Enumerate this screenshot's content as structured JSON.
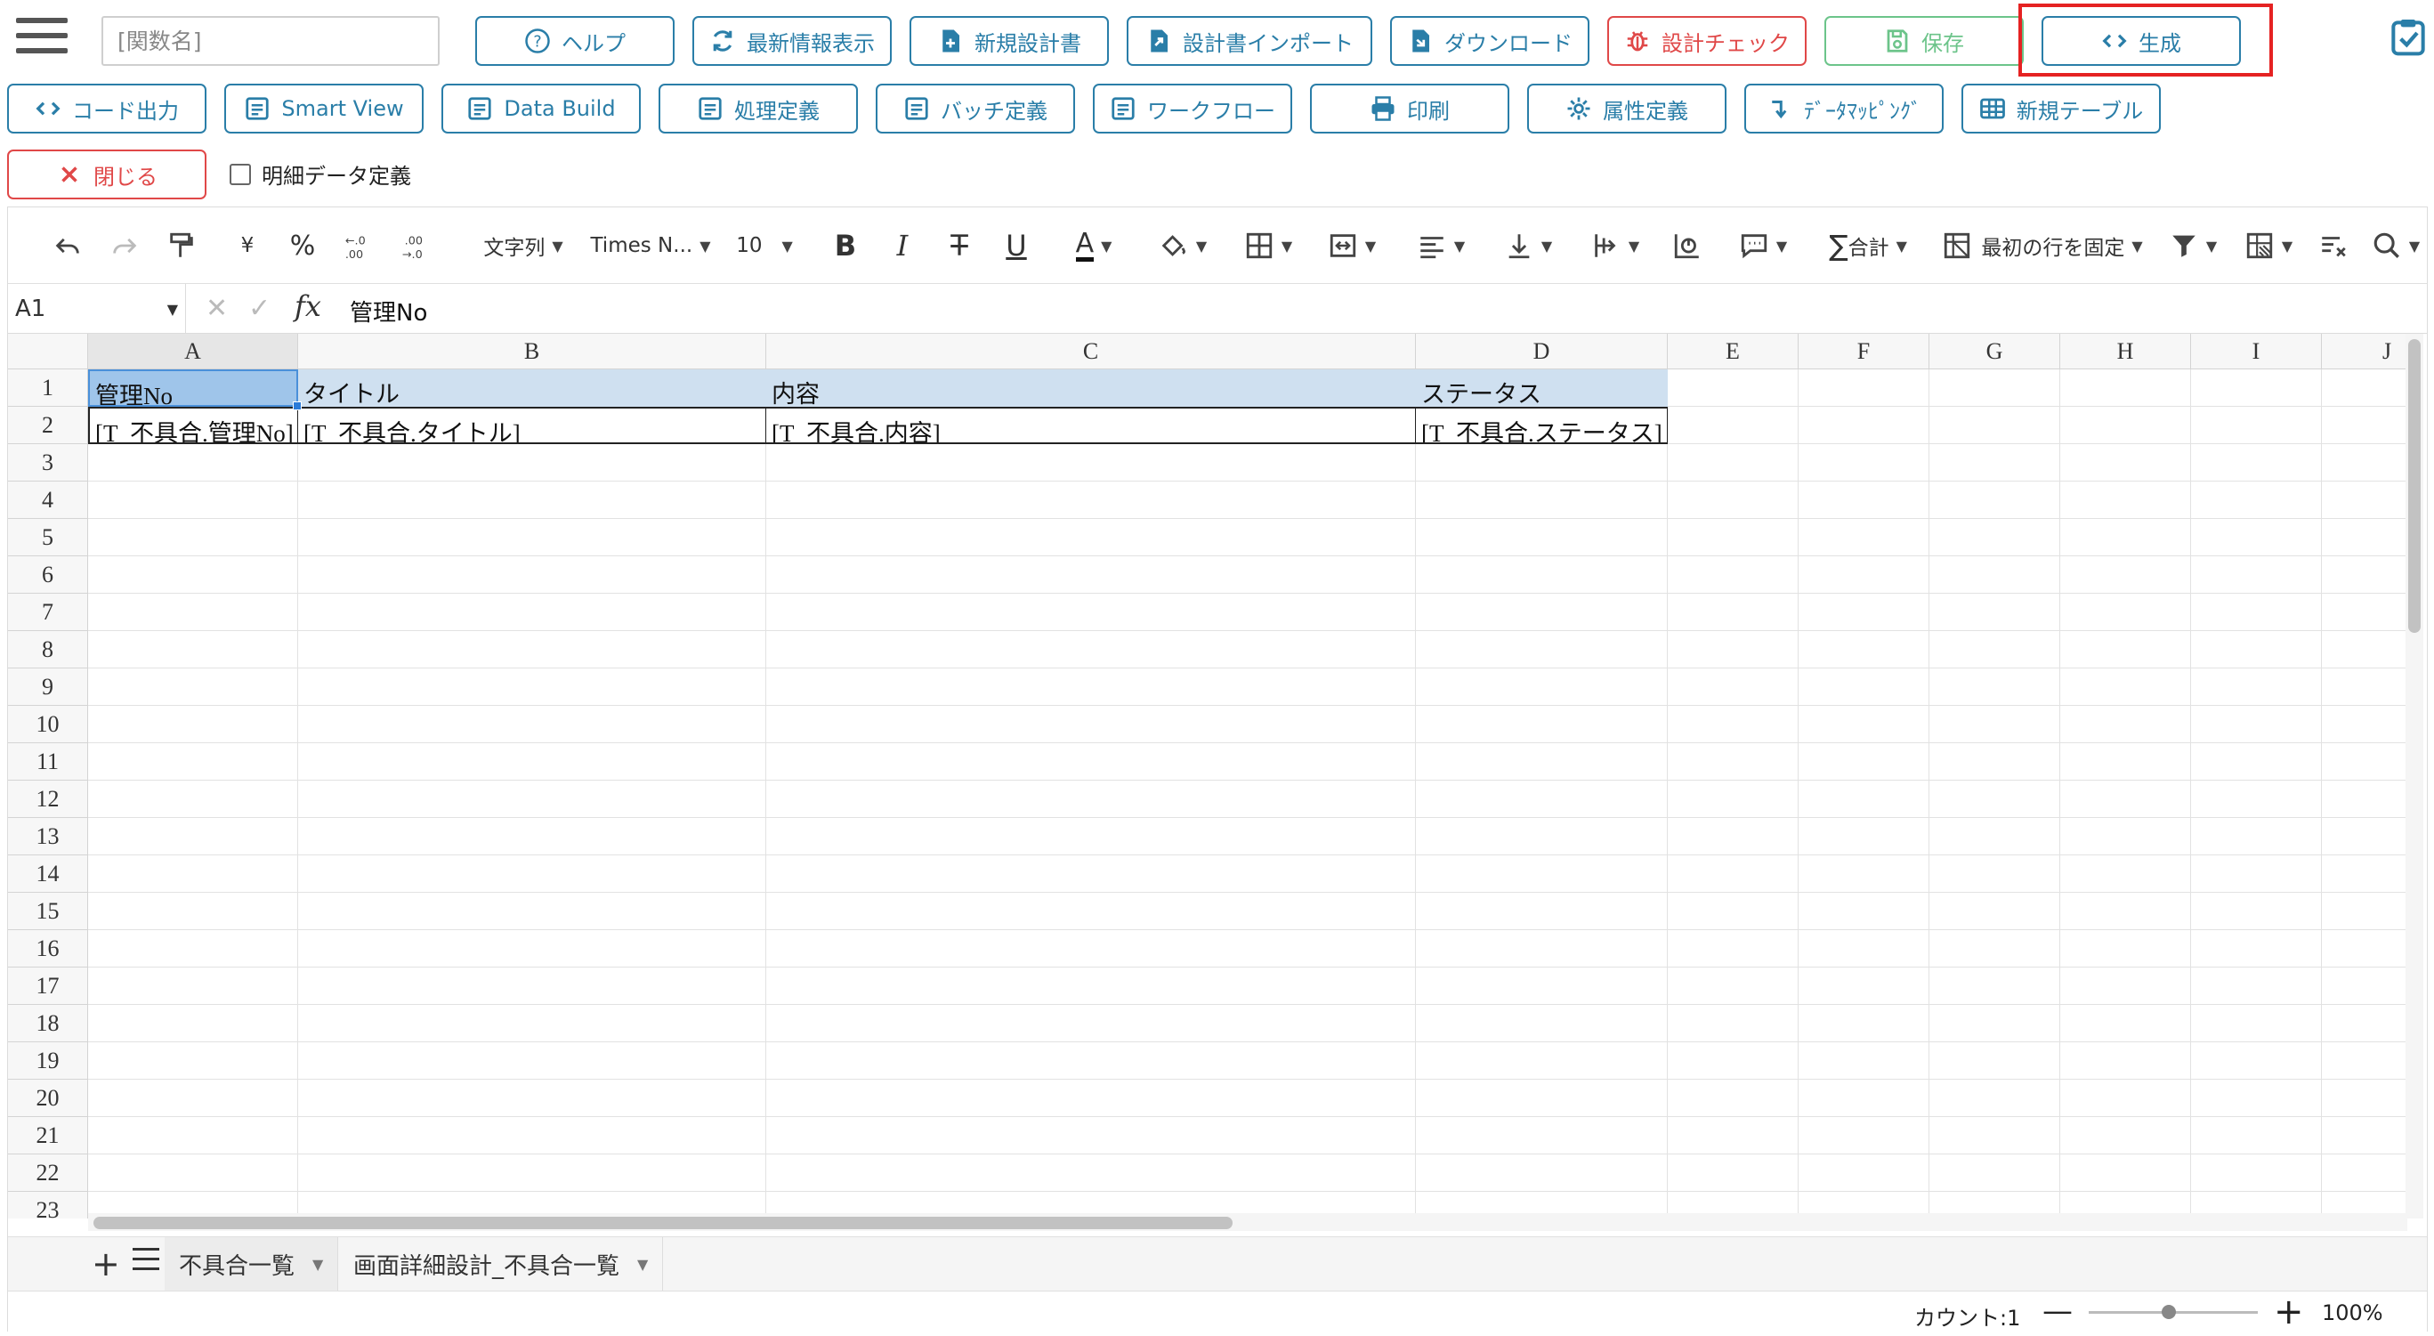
{
  "toolbar": {
    "funcname_placeholder": "[関数名]",
    "help": "ヘルプ",
    "refresh": "最新情報表示",
    "new_design": "新規設計書",
    "import": "設計書インポート",
    "download": "ダウンロード",
    "design_check": "設計チェック",
    "save": "保存",
    "generate": "生成"
  },
  "toolbar2": {
    "code_output": "コード出力",
    "smart_view": "Smart View",
    "data_build": "Data Build",
    "process_def": "処理定義",
    "batch_def": "バッチ定義",
    "workflow": "ワークフロー",
    "print": "印刷",
    "attr_def": "属性定義",
    "data_mapping": "ﾃﾞｰﾀﾏｯﾋﾟﾝｸﾞ",
    "new_table": "新規テーブル"
  },
  "toolbar3": {
    "close": "閉じる",
    "detail_checkbox": "明細データ定義"
  },
  "ribbon": {
    "currency": "¥",
    "percent": "%",
    "number_format": "文字列",
    "font_name": "Times N...",
    "font_size": "10",
    "sum": "合計",
    "freeze": "最初の行を固定"
  },
  "formula": {
    "cell_ref": "A1",
    "fx": "fx",
    "value": "管理No"
  },
  "columns": [
    "A",
    "B",
    "C",
    "D",
    "E",
    "F",
    "G",
    "H",
    "I",
    "J"
  ],
  "rows": [
    "1",
    "2",
    "3",
    "4",
    "5",
    "6",
    "7",
    "8",
    "9",
    "10",
    "11",
    "12",
    "13",
    "14",
    "15",
    "16",
    "17",
    "18",
    "19",
    "20",
    "21",
    "22",
    "23"
  ],
  "cells": {
    "r1": [
      "管理No",
      "タイトル",
      "内容",
      "ステータス"
    ],
    "r2": [
      "[T_不具合.管理No]",
      "[T_不具合.タイトル]",
      "[T_不具合.内容]",
      "[T_不具合.ステータス]"
    ]
  },
  "tabs": [
    {
      "label": "不具合一覧",
      "active": true
    },
    {
      "label": "画面詳細設計_不具合一覧",
      "active": false
    }
  ],
  "status": {
    "count": "カウント:1",
    "zoom": "100%",
    "zoom_level": 100
  },
  "colors": {
    "primary": "#2a7ea8",
    "danger": "#e04848",
    "save_muted": "#6cc48a",
    "highlight": "#e52222",
    "header_fill": "#cfe0f0",
    "selection_fill": "#9fc5ea"
  }
}
